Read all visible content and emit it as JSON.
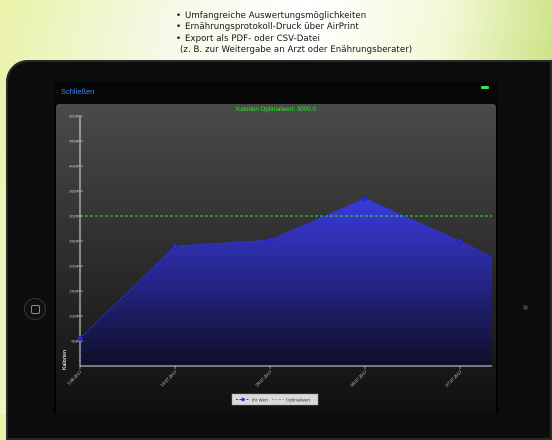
{
  "bullets": [
    "Umfangreiche Auswertungsmöglichkeiten",
    "Ernährungsprotokoll-Druck über AirPrint",
    "Export als PDF- oder CSV-Datei"
  ],
  "bullet_sub": "(z. B. zur Weitergabe an Arzt oder Enährungsberater)",
  "bullet_char": "•",
  "navbar": {
    "back_label": "Schließen"
  },
  "colors": {
    "series": "#3333ff",
    "optimum": "#22ee22",
    "axis": "#dddddd",
    "back_link": "#3b86ff"
  },
  "chart_data": {
    "type": "area",
    "title": "Kalorien Optimalwert: 3000.0",
    "ylabel": "Kalorien",
    "xlabel": "",
    "ylim": [
      0,
      5000
    ],
    "yticks": [
      500,
      1000,
      1500,
      2000,
      2500,
      3000,
      3500,
      4000,
      4500,
      5000
    ],
    "xticks": [
      "1.06.2017",
      "13.07.2017",
      "29.07.2017",
      "06.07.2017",
      "07.07.2017"
    ],
    "series": [
      {
        "name": "Ihr Wert",
        "x": [
          "1.06.2017",
          "13.07.2017",
          "29.07.2017",
          "06.07.2017",
          "07.07.2017",
          ""
        ],
        "values": [
          550,
          2400,
          2520,
          3350,
          2500,
          2180
        ]
      }
    ],
    "reference_line": {
      "name": "Optimalwert",
      "value": 3000
    },
    "legend": [
      "Ihr Wert",
      "Optimalwert"
    ],
    "legend_position": "bottom-center",
    "grid": false
  }
}
